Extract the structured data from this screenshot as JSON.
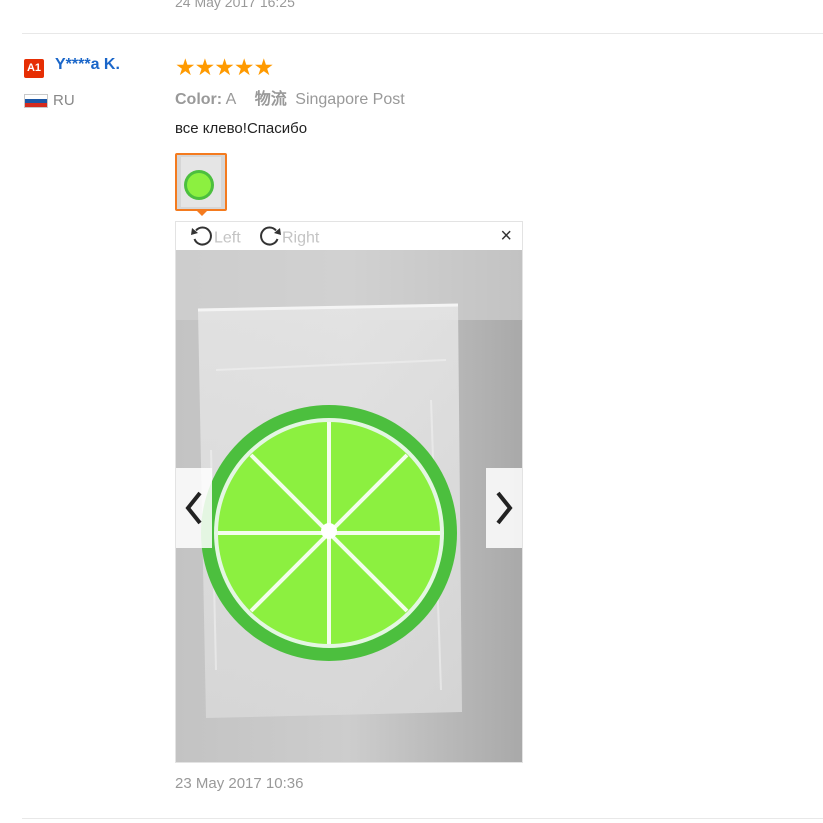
{
  "previous_review": {
    "date": "24 May 2017 16:25"
  },
  "review": {
    "user": {
      "level_badge": "A1",
      "name": "Y****a K.",
      "country": "RU",
      "flag_colors": [
        "#ffffff",
        "#1c57a5",
        "#d52b1e"
      ]
    },
    "rating": {
      "stars": 5,
      "max": 5,
      "star_glyphs": "★★★★★",
      "color": "#ff9a00"
    },
    "color_label": "Color:",
    "color_value": "A",
    "shipping_label": "物流",
    "shipping_value": "Singapore Post",
    "comment": "все клево!Спасибо",
    "photos_count": 1,
    "viewer": {
      "rotate_left_label": "Left",
      "rotate_right_label": "Right",
      "close_glyph": "×"
    },
    "date": "23 May 2017 10:36"
  },
  "colors": {
    "username": "#1a66c9",
    "badge": "#e62e04",
    "thumb_border": "#f47b1f",
    "lime_rim": "#4cbf3e",
    "lime_flesh": "#8cf040"
  },
  "icons": {
    "rotate_left": "rotate-left-icon",
    "rotate_right": "rotate-right-icon",
    "prev": "chevron-left-icon",
    "next": "chevron-right-icon",
    "close": "close-icon"
  }
}
